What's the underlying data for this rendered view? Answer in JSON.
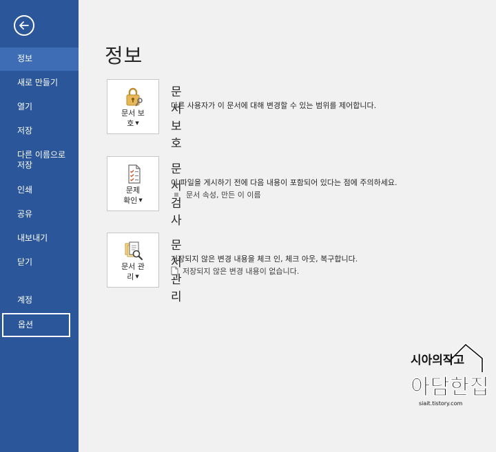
{
  "sidebar": {
    "items": [
      {
        "label": "정보",
        "active": true
      },
      {
        "label": "새로 만들기"
      },
      {
        "label": "열기"
      },
      {
        "label": "저장"
      },
      {
        "label": "다른 이름으로\n저장"
      },
      {
        "label": "인쇄"
      },
      {
        "label": "공유"
      },
      {
        "label": "내보내기"
      },
      {
        "label": "닫기"
      },
      {
        "label": "계정"
      },
      {
        "label": "옵션",
        "highlighted": true
      }
    ]
  },
  "main": {
    "title": "정보",
    "sections": [
      {
        "tile_label_1": "문서 보",
        "tile_label_2": "호",
        "title": "문서 보호",
        "description": "다른 사용자가 이 문서에 대해 변경할 수 있는 범위를 제어합니다."
      },
      {
        "tile_label_1": "문제",
        "tile_label_2": "확인",
        "title": "문서 검사",
        "description": "이 파일을 게시하기 전에 다음 내용이 포함되어 있다는 점에 주의하세요.",
        "sub_item": "문서 속성, 만든 이 이름"
      },
      {
        "tile_label_1": "문서 관",
        "tile_label_2": "리",
        "title": "문서 관리",
        "description": "저장되지 않은 변경 내용을 체크 인, 체크 아웃, 복구합니다.",
        "sub_item": "저장되지 않은 변경 내용이 없습니다."
      }
    ]
  },
  "watermark": {
    "line1": "시아의작고",
    "line2": "아담한집",
    "url": "siait.tistory.com"
  },
  "colors": {
    "sidebar": "#2b579a",
    "active_item": "#3e6db5",
    "background": "#f1f1f1"
  }
}
